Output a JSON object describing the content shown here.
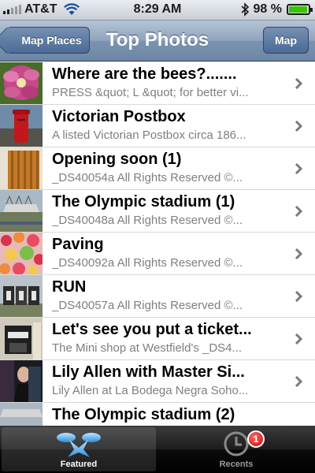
{
  "status_bar": {
    "carrier": "AT&T",
    "time": "8:29 AM",
    "battery": "98 %",
    "battery_level": 0.98
  },
  "nav": {
    "back_label": "Map Places",
    "title": "Top Photos",
    "right_label": "Map"
  },
  "photos": [
    {
      "title": "Where are the bees?.......",
      "subtitle": "PRESS &quot; L &quot; for better vi..."
    },
    {
      "title": "Victorian Postbox",
      "subtitle": "A listed Victorian Postbox circa 186..."
    },
    {
      "title": "Opening soon (1)",
      "subtitle": "_DS40054a   All Rights Reserved ©..."
    },
    {
      "title": "The Olympic stadium (1)",
      "subtitle": "_DS40048a   All Rights Reserved ©..."
    },
    {
      "title": "Paving",
      "subtitle": "_DS40092a   All Rights Reserved ©..."
    },
    {
      "title": "RUN",
      "subtitle": "_DS40057a   All Rights Reserved ©..."
    },
    {
      "title": "Let's see you put a ticket...",
      "subtitle": "The Mini shop at Westfield's   _DS4..."
    },
    {
      "title": "Lily Allen with Master Si...",
      "subtitle": "Lily Allen at La Bodega Negra Soho..."
    },
    {
      "title": "The Olympic stadium (2)",
      "subtitle": ""
    }
  ],
  "tabs": [
    {
      "label": "Featured",
      "icon": "featured-x-icon",
      "active": true
    },
    {
      "label": "Recents",
      "icon": "clock-icon",
      "badge": "1",
      "active": false
    }
  ]
}
